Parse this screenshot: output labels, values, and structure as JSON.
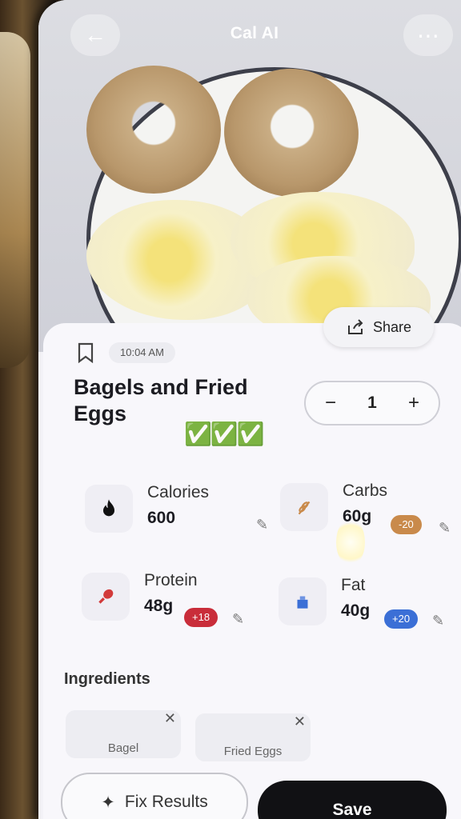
{
  "header": {
    "title": "Cal AI",
    "back_icon": "back-arrow-icon",
    "menu_icon": "more-icon"
  },
  "share": {
    "label": "Share"
  },
  "meal": {
    "time": "10:04 AM",
    "name": "Bagels and Fried Eggs",
    "emoji": "✅✅✅",
    "quantity": "1",
    "minus": "−",
    "plus": "+"
  },
  "macros": {
    "calories": {
      "label": "Calories",
      "value": "600",
      "icon": "flame-icon"
    },
    "carbs": {
      "label": "Carbs",
      "value": "60g",
      "delta": "-20",
      "delta_color": "#c98a4b",
      "icon": "wheat-icon"
    },
    "protein": {
      "label": "Protein",
      "value": "48g",
      "delta": "+18",
      "delta_color": "#c92d3a",
      "icon": "drumstick-icon"
    },
    "fat": {
      "label": "Fat",
      "value": "40g",
      "delta": "+20",
      "delta_color": "#3b6fd6",
      "icon": "oil-drop-icon"
    }
  },
  "ingredients": {
    "title": "Ingredients",
    "items": [
      {
        "name": "Bagel"
      },
      {
        "name": "Fried Eggs"
      }
    ]
  },
  "actions": {
    "fix_label": "Fix Results",
    "save_label": "Save"
  }
}
